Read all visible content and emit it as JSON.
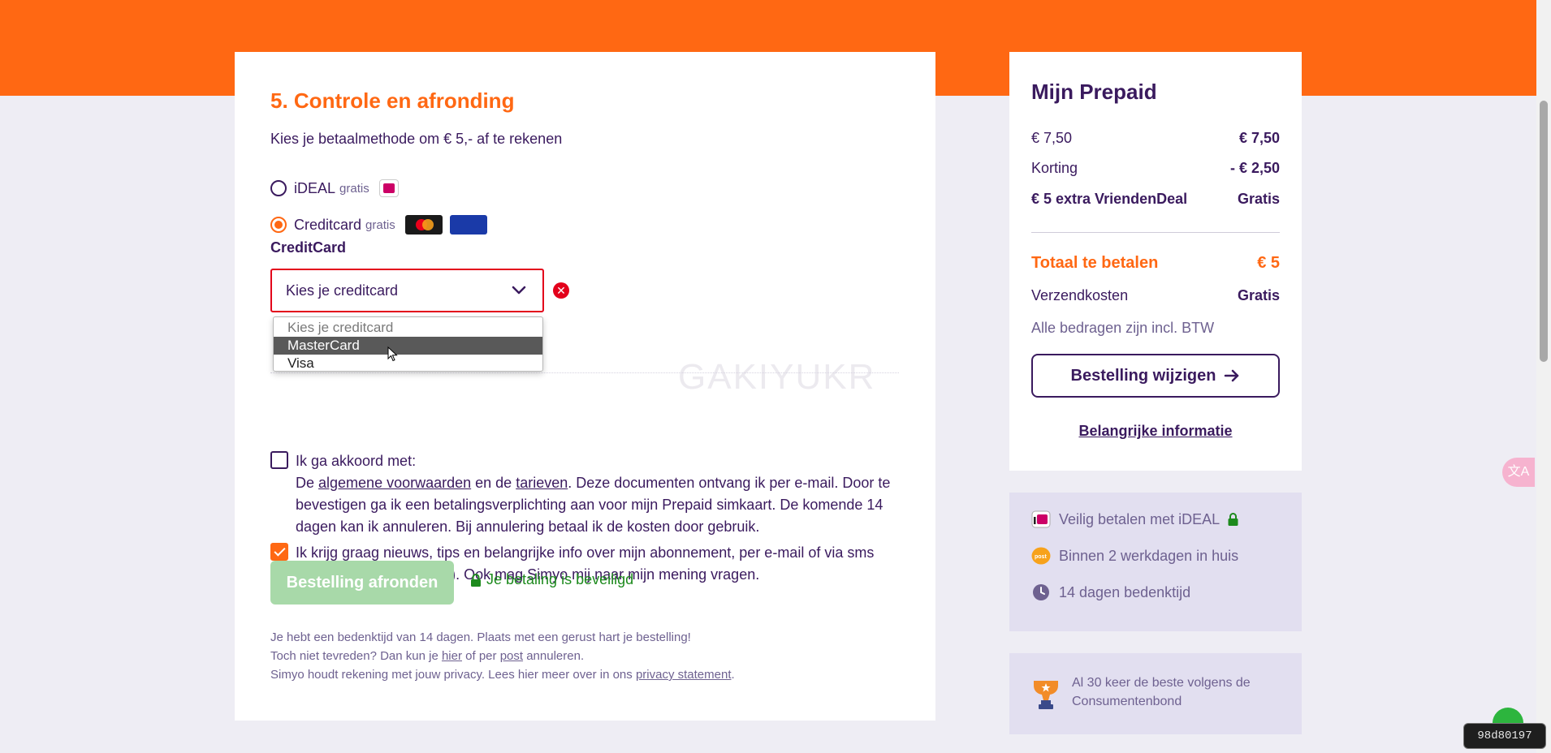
{
  "checkout": {
    "title": "5. Controle en afronding",
    "payment_prompt": "Kies je betaalmethode om € 5,- af te rekenen",
    "payment_options": [
      {
        "label": "iDEAL",
        "free": "gratis",
        "selected": false,
        "icon": "ideal-logo"
      },
      {
        "label": "Creditcard",
        "free": "gratis",
        "selected": true,
        "icons": [
          "mastercard-logo",
          "visa-logo"
        ]
      }
    ],
    "visa_text": "VISA",
    "ideal_logo_text": "iDEAL",
    "creditcard_field": {
      "label": "CreditCard",
      "value": "Kies je creditcard",
      "error": true,
      "options": [
        "Kies je creditcard",
        "MasterCard",
        "Visa"
      ],
      "highlighted": "MasterCard"
    },
    "watermark": "GAKIYUKR",
    "terms": {
      "checked": false,
      "heading": "Ik ga akkoord met:",
      "text_1": "De ",
      "link_av": "algemene voorwaarden",
      "text_2": " en de ",
      "link_tarieven": "tarieven",
      "text_3": ". Deze documenten ontvang ik per e-mail. Door te bevestigen ga ik een betalingsverplichting aan voor mijn Prepaid simkaart. De komende 14 dagen kan ik annuleren. Bij annulering betaal ik de kosten door gebruik."
    },
    "newsletter": {
      "checked": true,
      "text": "Ik krijg graag nieuws, tips en belangrijke info over mijn abonnement, per e-mail of via sms (max. 2 keer per maand). Ook mag Simyo mij naar mijn mening vragen."
    },
    "submit_label": "Bestelling afronden",
    "secure_label": "Je betaling is beveiligd",
    "footer": {
      "line1": "Je hebt een bedenktijd van 14 dagen. Plaats met een gerust hart je bestelling!",
      "line2_a": "Toch niet tevreden? Dan kun je ",
      "line2_link1": "hier",
      "line2_b": " of per ",
      "line2_link2": "post",
      "line2_c": " annuleren.",
      "line3_a": "Simyo houdt rekening met jouw privacy. Lees hier meer over in ons ",
      "line3_link": "privacy statement",
      "line3_b": "."
    }
  },
  "summary": {
    "title": "Mijn Prepaid",
    "rows": [
      {
        "label": "€ 7,50",
        "value": "€ 7,50"
      },
      {
        "label": "Korting",
        "value": "- € 2,50"
      },
      {
        "label": "€ 5 extra VriendenDeal",
        "value": "Gratis"
      }
    ],
    "total_label": "Totaal te betalen",
    "total_value": "€ 5",
    "shipping_label": "Verzendkosten",
    "shipping_value": "Gratis",
    "btw_note": "Alle bedragen zijn incl. BTW",
    "change_button": "Bestelling wijzigen",
    "info_link": "Belangrijke informatie"
  },
  "benefits": [
    {
      "icon": "ideal-icon",
      "text": "Veilig betalen met iDEAL"
    },
    {
      "icon": "postnl-icon",
      "text": "Binnen 2 werkdagen in huis"
    },
    {
      "icon": "clock-icon",
      "text": "14 dagen bedenktijd"
    }
  ],
  "postnl_text": "post",
  "award": {
    "text": "Al 30 keer de beste volgens de Consumentenbond"
  },
  "session_id": "98d80197",
  "translate_icon": "文A",
  "colors": {
    "brand_orange": "#ff6813",
    "brand_purple": "#3a1a5e",
    "error": "#e3001b",
    "success": "#1d8a1d",
    "disabled_button": "#a8d9a9"
  }
}
